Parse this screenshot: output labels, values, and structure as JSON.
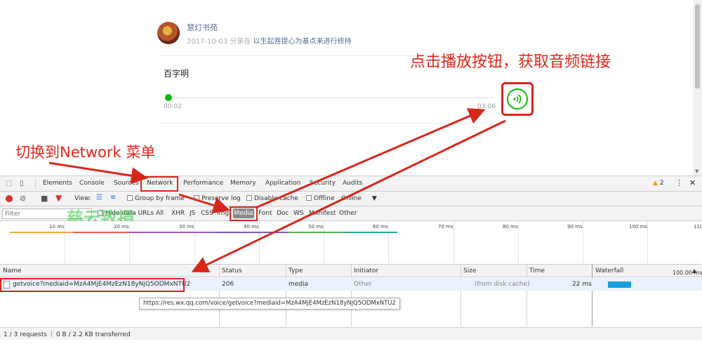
{
  "article": {
    "author": "慧灯书苑",
    "date": "2017-10-03",
    "shared_in": "分享在",
    "share_title": "以生起菩提心为基点来进行修持"
  },
  "audio": {
    "title": "百字明",
    "current_time": "00:02",
    "duration": "03:06",
    "progress_percent": 1
  },
  "annotations": {
    "click_play": "点击播放按钮，获取音频链接",
    "switch_network": "切换到Network 菜单"
  },
  "watermark": "慈云致捐",
  "devtools": {
    "tabs": [
      "Elements",
      "Console",
      "Sources",
      "Network",
      "Performance",
      "Memory",
      "Application",
      "Security",
      "Audits"
    ],
    "active_tab": "Network",
    "warnings_count": "2",
    "toolbar": {
      "view_label": "View:",
      "group_by_frame": "Group by frame",
      "preserve_log": "Preserve log",
      "disable_cache": "Disable cache",
      "offline": "Offline",
      "online": "Online"
    },
    "filter": {
      "placeholder": "Filter",
      "hide_data_urls": "Hide data URLs",
      "types": [
        "All",
        "XHR",
        "JS",
        "CSS",
        "Img",
        "Media",
        "Font",
        "Doc",
        "WS",
        "Manifest",
        "Other"
      ],
      "active_type": "Media"
    },
    "timeline_ticks": [
      "10 ms",
      "20 ms",
      "30 ms",
      "40 ms",
      "50 ms",
      "60 ms",
      "70 ms",
      "80 ms",
      "90 ms",
      "100 ms",
      "110"
    ],
    "columns": {
      "name": "Name",
      "status": "Status",
      "type": "Type",
      "initiator": "Initiator",
      "size": "Size",
      "time": "Time",
      "waterfall": "Waterfall"
    },
    "waterfall_scale": "100.00 ms",
    "request": {
      "name": "getvoice?mediaid=MzA4MjE4MzEzN18yNjQ5ODMxNTU2",
      "status": "206",
      "type": "media",
      "initiator": "Other",
      "size": "(from disk cache)",
      "time": "22 ms"
    },
    "tooltip_url": "https://res.wx.qq.com/voice/getvoice?mediaid=MzA4MjE4MzEzN18yNjQ5ODMxNTU2",
    "status_bar": {
      "requests": "1 / 3 requests",
      "transferred": "0 B / 2.2 KB transferred"
    }
  },
  "colors": {
    "annotation_red": "#d8261c",
    "wechat_green": "#09bb07",
    "watermark_green": "#2ec83c",
    "waterfall_blue": "#1a9fe0"
  }
}
